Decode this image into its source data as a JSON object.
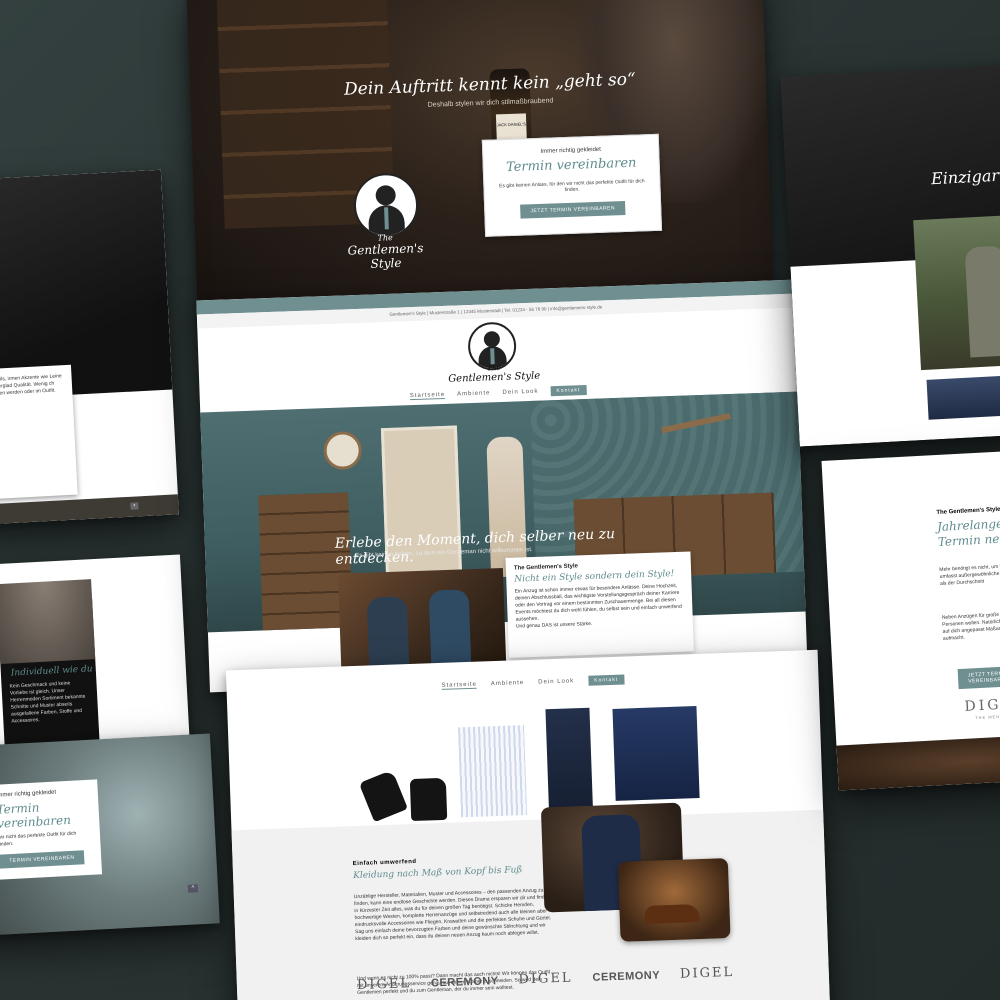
{
  "hero": {
    "headline": "Dein Auftritt kennt kein „geht so“",
    "subline": "Deshalb stylen wir dich stilmaßbraubend",
    "logo_line1": "The",
    "logo_line2": "Gentlemen's Style",
    "bottle_label": "JACK DANIEL'S",
    "card_kicker": "Immer richtig gekleidet",
    "card_title": "Termin vereinbaren",
    "card_body": "Es gibt keinen Anlass, für den wir nicht das perfekte Outfit für dich finden.",
    "card_button": "JETZT TERMIN VEREINBAREN",
    "up_arrow": "^"
  },
  "left_top": {
    "text": "Details, irmen Akzente wie Leine Lederglad Qualität. Wenig ch lenken werden oder im Outfit.",
    "up_arrow": "▪"
  },
  "left_mid": {
    "title": "Individuell wie du",
    "text": "Kein Geschmack und keine Vorliebe ist gleich. Unser Herrenmoden Sortiment bekannte Schnitte und Muster abseits ausgefallene Farben, Stoffe und Accessoires."
  },
  "left_bot": {
    "kicker": "Immer richtig gekleidet",
    "title": "Termin vereinbaren",
    "text": "wir nicht das perfekte Outfit für dich finden.",
    "button": "TERMIN VEREINBAREN",
    "up_arrow": "^"
  },
  "main": {
    "infobar": "Gentlemen's Style | Musterstraße 1 | 12345 Musterstadt | Tel. 01234 - 56 78 90 | info@gentlemens-style.de",
    "logo_line1": "The",
    "logo_line2": "Gentlemen's Style",
    "nav": {
      "items": [
        "Startseite",
        "Ambiente",
        "Dein Look"
      ],
      "contact": "Kontakt"
    },
    "hero_line": "Erlebe den Moment, dich selber neu zu entdecken.",
    "hero_sub": "Es gibt keinen Anlass, zu dem ein Gentleman nicht willkommen ist.",
    "card_kicker": "The Gentlemen's Style",
    "card_title": "Nicht ein Style sondern dein Style!",
    "card_body": "Ein Anzug ist schon immer etwas für besondere Anlässe. Deine Hochzeit, deinen Abschlussball, das wichtigste Vorstellungsgespräch deiner Karriere oder den Vortrag vor einem bestimmten Zuschauermenge. Bei all diesen Events möchtest du dich wohl fühlen, du selbst sein und einfach unwerfend aussehen.",
    "card_end": "Und genau DAS ist unsere Stärke."
  },
  "products": {
    "nav": {
      "items": [
        "Startseite",
        "Ambiente",
        "Dein Look"
      ],
      "contact": "Kontakt"
    },
    "kicker": "Einfach umwerfend",
    "title": "Kleidung nach Maß von Kopf bis Fuß",
    "para1": "Unzählige Hersteller, Materialien, Muster und Accessoires – den passenden Anzug zu finden, kann eine endlose Geschichte werden. Dieses Drama ersparen wir dir und finden in kürzester Zeit alles, was du für deinen großen Tag benötigst. Schicke Hemden, hochwertige Westen, komplette Herrenanzüge und selbstredend auch alle kleinen aber eindrucksvolle Accessoires wie Fliegen, Krawatten und die perfekten Schuhe und Gürtel. Sag uns einfach deine bevorzugten Farben und deine gewünschte Stilrichtung und wir kleiden dich so perfekt ein, dass du deinen neuen Anzug kaum noch ablegen willst.",
    "para2": "Und wenn es nicht zu 100% passt? Dann macht das auch nichts! Wir können das Outfit mit unserem Änderungsservice genau auf deinen Körper zuschneiden. So wird dein Gentlemen perfekt und du zum Gentleman, der du immer sein wolltest.",
    "brands": [
      "DIGEL",
      "CEREMONY",
      "DIGEL",
      "CEREMONY",
      "DIGEL"
    ]
  },
  "right_top": {
    "title": "Einzigartig"
  },
  "right_mid": {
    "kicker": "The Gentlemen's Style",
    "title_line1": "Jahrelange",
    "title_line2": "Termin ne",
    "para1": "Mehr benötigt es nicht, um Unser Sortiment umfasst außergewöhnliche Schnitte Keiner als der Durchschnitt",
    "para2": "Neben Anzügen für große Größen für kleine Personen wollen. Natürlich können genauer auf dich angepasst Maßanzug perfekt aufmacht.",
    "button": "JETZT TERMIN VEREINBAREN",
    "brand": "DIGEL",
    "brand_sub": "THE MENSWEAR COMPANY"
  },
  "colors": {
    "accent": "#6f8f90",
    "background": "#2a3433",
    "text": "#333333"
  }
}
